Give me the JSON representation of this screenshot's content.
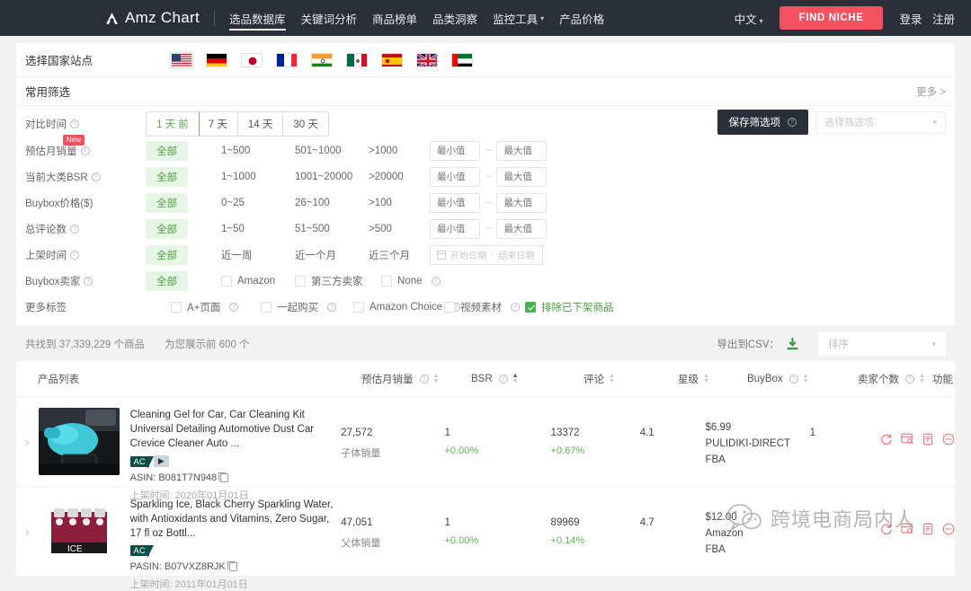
{
  "nav": {
    "brand": "Amz Chart",
    "links": [
      {
        "label": "选品数据库",
        "active": true,
        "caret": false
      },
      {
        "label": "关键词分析",
        "active": false,
        "caret": false
      },
      {
        "label": "商品榜单",
        "active": false,
        "caret": false
      },
      {
        "label": "品类洞察",
        "active": false,
        "caret": false
      },
      {
        "label": "监控工具",
        "active": false,
        "caret": true
      },
      {
        "label": "产品价格",
        "active": false,
        "caret": false
      }
    ],
    "language": "中文",
    "cta": "FIND NICHE",
    "login": "登录",
    "register": "注册"
  },
  "country": {
    "label": "选择国家站点",
    "items": [
      "us-flag",
      "de-flag",
      "jp-flag",
      "fr-flag",
      "in-flag",
      "mx-flag",
      "es-flag",
      "uk-flag",
      "ae-flag"
    ],
    "selected": "us-flag"
  },
  "common_filter": {
    "title": "常用筛选",
    "more": "更多 >"
  },
  "filters": {
    "compare_time": {
      "label": "对比时间",
      "options": [
        "1 天 前",
        "7 天",
        "14 天",
        "30 天"
      ],
      "selected": "1 天 前"
    },
    "monthly_sales": {
      "label": "预估月销量",
      "badge": "New",
      "all": "全部",
      "options": [
        "1~500",
        "501~1000",
        ">1000"
      ],
      "min_placeholder": "最小值",
      "max_placeholder": "最大值",
      "min_value": "",
      "max_value": ""
    },
    "bsr": {
      "label": "当前大类BSR",
      "all": "全部",
      "options": [
        "1~1000",
        "1001~20000",
        ">20000"
      ],
      "min_placeholder": "最小值",
      "max_placeholder": "最大值",
      "min_value": "",
      "max_value": ""
    },
    "buybox_price": {
      "label": "Buybox价格($)",
      "all": "全部",
      "options": [
        "0~25",
        "26~100",
        ">100"
      ],
      "min_placeholder": "最小值",
      "max_placeholder": "最大值",
      "min_value": "",
      "max_value": ""
    },
    "reviews": {
      "label": "总评论数",
      "all": "全部",
      "options": [
        "1~50",
        "51~500",
        ">500"
      ],
      "min_placeholder": "最小值",
      "max_placeholder": "最大值",
      "min_value": "",
      "max_value": ""
    },
    "listing_date": {
      "label": "上架时间",
      "all": "全部",
      "options": [
        "近一周",
        "近一个月",
        "近三个月"
      ],
      "start_placeholder": "开始日期",
      "end_placeholder": "结束日期",
      "separator": "-"
    },
    "buybox_seller": {
      "label": "Buybox卖家",
      "all": "全部",
      "options": [
        {
          "label": "Amazon",
          "checked": false,
          "help": false
        },
        {
          "label": "第三方卖家",
          "checked": false,
          "help": false
        },
        {
          "label": "None",
          "checked": false,
          "help": true
        }
      ]
    },
    "more_tags": {
      "label": "更多标签",
      "options": [
        {
          "label": "A+页面",
          "checked": false,
          "help": true
        },
        {
          "label": "一起购买",
          "checked": false,
          "help": true
        },
        {
          "label": "Amazon Choice",
          "checked": false,
          "help": true
        },
        {
          "label": "视频素材",
          "checked": false,
          "help": true
        },
        {
          "label": "排除已下架商品",
          "checked": true,
          "help": false
        }
      ]
    },
    "save": {
      "button": "保存筛选项",
      "select_placeholder": "选择筛选项"
    }
  },
  "results": {
    "found": "共找到 37,339,229 个商品",
    "showing": "为您展示前 600 个",
    "export_label": "导出到CSV：",
    "sort_placeholder": "排序"
  },
  "table": {
    "columns": [
      {
        "label": "产品列表",
        "sortable": false
      },
      {
        "label": "预估月销量",
        "help": true,
        "sortable": true,
        "sort": "none"
      },
      {
        "label": "BSR",
        "help": true,
        "sortable": true,
        "sort": "asc"
      },
      {
        "label": "评论",
        "help": false,
        "sortable": true,
        "sort": "none"
      },
      {
        "label": "星级",
        "help": false,
        "sortable": true,
        "sort": "none"
      },
      {
        "label": "BuyBox",
        "help": true,
        "sortable": true,
        "sort": "none"
      },
      {
        "label": "卖家个数",
        "help": true,
        "sortable": true,
        "sort": "none"
      },
      {
        "label": "功能",
        "help": false,
        "sortable": false
      }
    ],
    "rows": [
      {
        "title": "Cleaning Gel for Car, Car Cleaning Kit Universal Detailing Automotive Dust Car Crevice Cleaner Auto ...",
        "badges": [
          "AC",
          "video"
        ],
        "asin_label": "ASIN: B081T7N948",
        "date": "上架时间: 2020年01月01日",
        "monthly_sales": "27,572",
        "sales_type": "子体销量",
        "bsr": "1",
        "bsr_pct": "+0.00%",
        "reviews": "13372",
        "reviews_pct": "+0.67%",
        "rating": "4.1",
        "buybox_price": "$6.99",
        "buybox_seller": "PULIDIKI-DIRECT",
        "buybox_fulfil": "FBA",
        "seller_count": "1",
        "actions": [
          "refresh-icon",
          "chart-icon",
          "report-icon",
          "more-icon"
        ]
      },
      {
        "title": "Sparkling Ice, Black Cherry Sparkling Water, with Antioxidants and Vitamins, Zero Sugar, 17 fl oz Bottl...",
        "badges": [
          "AC"
        ],
        "asin_label": "PASIN: B07VXZ8RJK",
        "date": "上架时间: 2011年01月01日",
        "monthly_sales": "47,051",
        "sales_type": "父体销量",
        "bsr": "1",
        "bsr_pct": "+0.00%",
        "reviews": "89969",
        "reviews_pct": "+0.14%",
        "rating": "4.7",
        "buybox_price": "$12.00",
        "buybox_seller": "Amazon",
        "buybox_fulfil": "FBA",
        "seller_count": "",
        "actions": [
          "refresh-icon",
          "chart-icon",
          "report-icon",
          "more-icon"
        ]
      }
    ]
  },
  "watermark": {
    "text": "跨境电商局内人"
  },
  "colors": {
    "nav_bg": "#2b2f3a",
    "accent_red": "#f2525f",
    "accent_green": "#4a9c3f",
    "action_icon": "#f07070"
  }
}
